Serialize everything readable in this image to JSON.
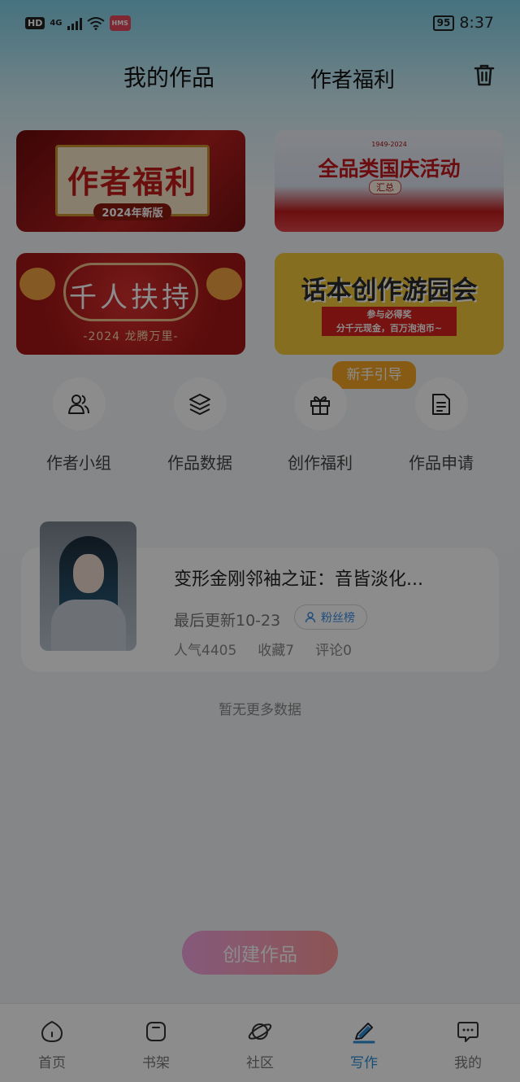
{
  "status_bar": {
    "hd": "HD",
    "network": "4G",
    "hms": "HMS",
    "battery": "95",
    "time": "8:37"
  },
  "header": {
    "tab_works": "我的作品",
    "tab_welfare": "作者福利",
    "trash_icon": "trash-icon"
  },
  "banners": {
    "b1": {
      "title": "作者福利",
      "sub": "2024年新版"
    },
    "b2": {
      "top": "1949-2024",
      "title": "全品类国庆活动",
      "sub": "汇总"
    },
    "b3": {
      "title": "千人扶持",
      "sub": "-2024 龙腾万里-"
    },
    "b4": {
      "title": "话本创作游园会",
      "line1": "参与必得奖",
      "line2": "分千元现金，百万泡泡币~"
    }
  },
  "guide_badge": "新手引导",
  "functions": [
    {
      "label": "作者小组",
      "icon": "users-icon"
    },
    {
      "label": "作品数据",
      "icon": "layers-icon"
    },
    {
      "label": "创作福利",
      "icon": "gift-icon"
    },
    {
      "label": "作品申请",
      "icon": "document-icon"
    }
  ],
  "work": {
    "title": "变形金刚邻袖之证：音皆淡化...",
    "update": "最后更新10-23",
    "fans_label": "粉丝榜",
    "popularity": "人气4405",
    "favorites": "收藏7",
    "comments": "评论0"
  },
  "no_more": "暂无更多数据",
  "create_button": "创建作品",
  "nav": [
    {
      "label": "首页",
      "icon": "home-icon"
    },
    {
      "label": "书架",
      "icon": "bookshelf-icon"
    },
    {
      "label": "社区",
      "icon": "planet-icon"
    },
    {
      "label": "写作",
      "icon": "pen-icon"
    },
    {
      "label": "我的",
      "icon": "chat-icon"
    }
  ],
  "colors": {
    "accent": "#2b8fd8",
    "guide": "#f6a623",
    "create_start": "#f3a3e0",
    "create_end": "#ff9a9a"
  }
}
